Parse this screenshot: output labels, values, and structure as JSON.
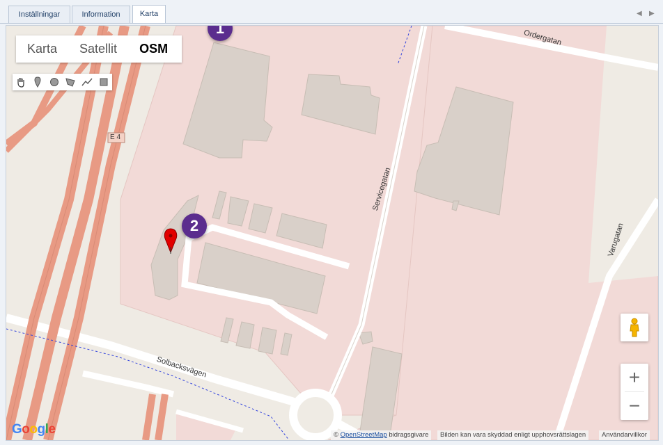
{
  "tabs": [
    {
      "label": "Inställningar",
      "active": false
    },
    {
      "label": "Information",
      "active": false
    },
    {
      "label": "Karta",
      "active": true
    }
  ],
  "map": {
    "type_options": [
      "Karta",
      "Satellit",
      "OSM"
    ],
    "selected_type": "OSM",
    "draw_tools": [
      "hand-icon",
      "marker-icon",
      "circle-icon",
      "polygon-icon",
      "polyline-icon",
      "rectangle-icon"
    ],
    "badges": [
      "1",
      "2"
    ],
    "road_labels": {
      "ordergatan": "Ordergatan",
      "servicegatan": "Servicegatan",
      "varugatan": "Varugatan",
      "solbacksvagen": "Solbacksvägen",
      "e4": "E 4"
    },
    "zoom_in": "+",
    "zoom_out": "−",
    "google_logo": "Google",
    "attribution": {
      "prefix": "©",
      "osm_link": "OpenStreetMap",
      "contributors": "bidragsgivare",
      "copyright": "Bilden kan vara skyddad enligt upphovsrättslagen",
      "terms": "Användarvillkor"
    },
    "colors": {
      "industrial": "#f2dad7",
      "building": "#d9d0c9",
      "motorway": "#e89a84",
      "road": "#ffffff",
      "background": "#efebe4",
      "badge": "#5b2d8e",
      "marker": "#e20000"
    }
  }
}
